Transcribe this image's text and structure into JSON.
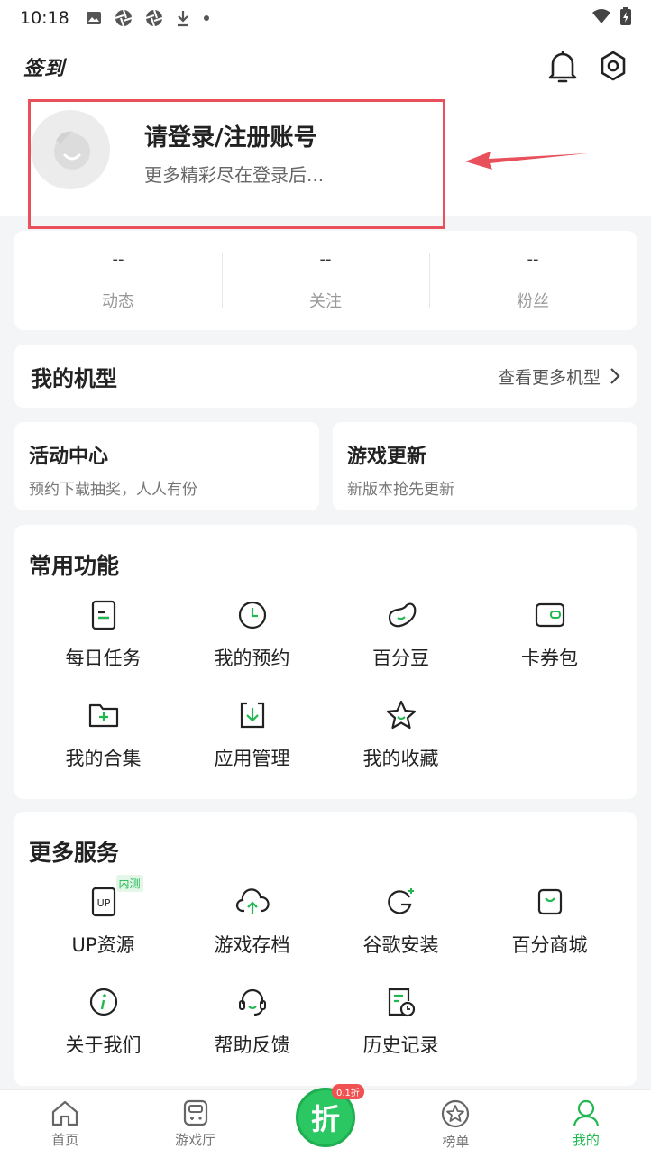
{
  "status": {
    "time": "10:18"
  },
  "header": {
    "signin_label": "签到"
  },
  "login": {
    "title": "请登录/注册账号",
    "subtitle": "更多精彩尽在登录后..."
  },
  "stats": [
    {
      "value": "--",
      "label": "动态"
    },
    {
      "value": "--",
      "label": "关注"
    },
    {
      "value": "--",
      "label": "粉丝"
    }
  ],
  "models": {
    "title": "我的机型",
    "more": "查看更多机型"
  },
  "activity": {
    "title": "活动中心",
    "subtitle": "预约下载抽奖，人人有份"
  },
  "update": {
    "title": "游戏更新",
    "subtitle": "新版本抢先更新"
  },
  "common": {
    "title": "常用功能",
    "items": [
      "每日任务",
      "我的预约",
      "百分豆",
      "卡券包",
      "我的合集",
      "应用管理",
      "我的收藏"
    ]
  },
  "services": {
    "title": "更多服务",
    "badge": "内测",
    "items": [
      "UP资源",
      "游戏存档",
      "谷歌安装",
      "百分商城",
      "关于我们",
      "帮助反馈",
      "历史记录"
    ]
  },
  "tabbar": {
    "items": [
      "首页",
      "游戏厅",
      "榜单",
      "我的"
    ],
    "center_label": "折",
    "center_badge": "0.1折"
  },
  "colors": {
    "accent": "#1fb950",
    "highlight": "#e8505b"
  }
}
